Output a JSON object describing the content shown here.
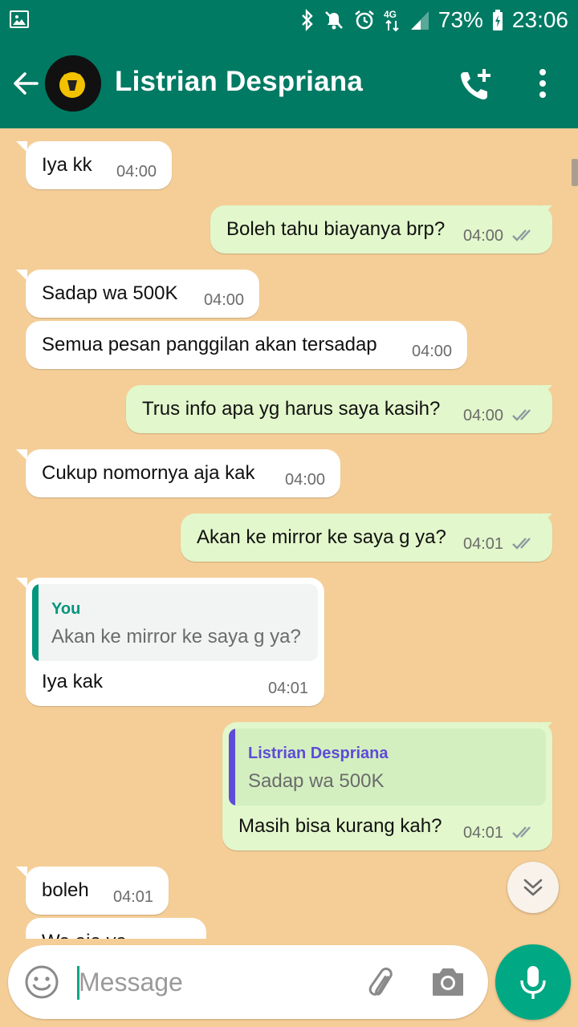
{
  "status_bar": {
    "battery": "73%",
    "time": "23:06",
    "network": "4G"
  },
  "header": {
    "contact_name": "Listrian Despriana"
  },
  "messages": [
    {
      "dir": "in",
      "text": "Iya kk",
      "time": "04:00"
    },
    {
      "dir": "out",
      "text": "Boleh tahu biayanya brp?",
      "time": "04:00"
    },
    {
      "dir": "in",
      "text": "Sadap wa 500K",
      "time": "04:00"
    },
    {
      "dir": "in",
      "text": "Semua pesan panggilan akan tersadap",
      "time": "04:00"
    },
    {
      "dir": "out",
      "text": "Trus info apa yg harus saya kasih?",
      "time": "04:00"
    },
    {
      "dir": "in",
      "text": "Cukup nomornya aja kak",
      "time": "04:00"
    },
    {
      "dir": "out",
      "text": "Akan ke mirror ke saya g ya?",
      "time": "04:01"
    },
    {
      "dir": "in",
      "text": "Iya kak",
      "time": "04:01",
      "quote": {
        "author": "You",
        "text": "Akan ke mirror ke saya g ya?"
      }
    },
    {
      "dir": "out",
      "text": "Masih bisa kurang kah?",
      "time": "04:01",
      "quote": {
        "author": "Listrian Despriana",
        "text": "Sadap wa 500K"
      }
    },
    {
      "dir": "in",
      "text": "boleh",
      "time": "04:01"
    },
    {
      "dir": "in",
      "text": "Wa aja ya",
      "time": ""
    }
  ],
  "composer": {
    "placeholder": "Message"
  },
  "colors": {
    "header": "#007A63",
    "chat_background": "#F5CE97",
    "outgoing_bubble": "#E2F7CB",
    "incoming_bubble": "#FFFFFF",
    "accent": "#00A884",
    "quote_you": "#03967E",
    "quote_contact": "#5E4BD8",
    "read_ticks": "#8C99A0"
  },
  "icons": [
    "gallery-icon",
    "bluetooth-icon",
    "mute-icon",
    "alarm-icon",
    "signal-icon",
    "battery-icon",
    "back-arrow-icon",
    "add-call-icon",
    "more-vert-icon",
    "double-check-icon",
    "chevron-double-down-icon",
    "emoji-icon",
    "attach-icon",
    "camera-icon",
    "mic-icon"
  ]
}
